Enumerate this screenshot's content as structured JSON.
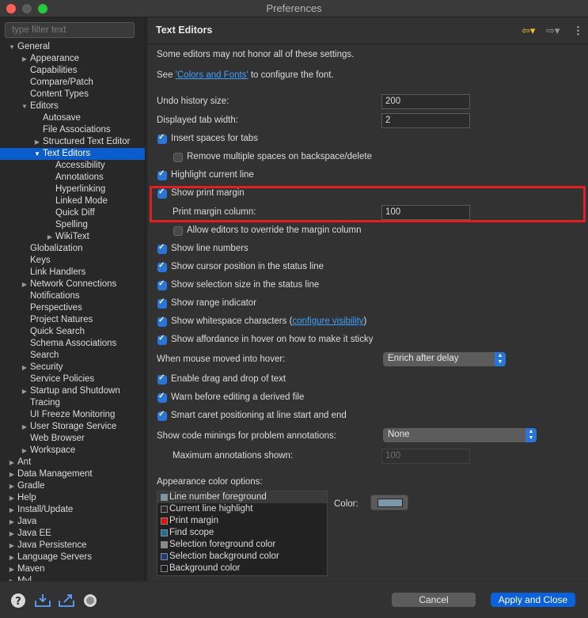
{
  "window": {
    "title": "Preferences"
  },
  "filter": {
    "placeholder": "type filter text"
  },
  "tree": [
    {
      "label": "General",
      "depth": 0,
      "twisty": "open"
    },
    {
      "label": "Appearance",
      "depth": 1,
      "twisty": "closed"
    },
    {
      "label": "Capabilities",
      "depth": 1,
      "twisty": ""
    },
    {
      "label": "Compare/Patch",
      "depth": 1,
      "twisty": ""
    },
    {
      "label": "Content Types",
      "depth": 1,
      "twisty": ""
    },
    {
      "label": "Editors",
      "depth": 1,
      "twisty": "open"
    },
    {
      "label": "Autosave",
      "depth": 2,
      "twisty": ""
    },
    {
      "label": "File Associations",
      "depth": 2,
      "twisty": ""
    },
    {
      "label": "Structured Text Editor",
      "depth": 2,
      "twisty": "closed"
    },
    {
      "label": "Text Editors",
      "depth": 2,
      "twisty": "open",
      "selected": true
    },
    {
      "label": "Accessibility",
      "depth": 3,
      "twisty": ""
    },
    {
      "label": "Annotations",
      "depth": 3,
      "twisty": ""
    },
    {
      "label": "Hyperlinking",
      "depth": 3,
      "twisty": ""
    },
    {
      "label": "Linked Mode",
      "depth": 3,
      "twisty": ""
    },
    {
      "label": "Quick Diff",
      "depth": 3,
      "twisty": ""
    },
    {
      "label": "Spelling",
      "depth": 3,
      "twisty": ""
    },
    {
      "label": "WikiText",
      "depth": 3,
      "twisty": "closed"
    },
    {
      "label": "Globalization",
      "depth": 1,
      "twisty": ""
    },
    {
      "label": "Keys",
      "depth": 1,
      "twisty": ""
    },
    {
      "label": "Link Handlers",
      "depth": 1,
      "twisty": ""
    },
    {
      "label": "Network Connections",
      "depth": 1,
      "twisty": "closed"
    },
    {
      "label": "Notifications",
      "depth": 1,
      "twisty": ""
    },
    {
      "label": "Perspectives",
      "depth": 1,
      "twisty": ""
    },
    {
      "label": "Project Natures",
      "depth": 1,
      "twisty": ""
    },
    {
      "label": "Quick Search",
      "depth": 1,
      "twisty": ""
    },
    {
      "label": "Schema Associations",
      "depth": 1,
      "twisty": ""
    },
    {
      "label": "Search",
      "depth": 1,
      "twisty": ""
    },
    {
      "label": "Security",
      "depth": 1,
      "twisty": "closed"
    },
    {
      "label": "Service Policies",
      "depth": 1,
      "twisty": ""
    },
    {
      "label": "Startup and Shutdown",
      "depth": 1,
      "twisty": "closed"
    },
    {
      "label": "Tracing",
      "depth": 1,
      "twisty": ""
    },
    {
      "label": "UI Freeze Monitoring",
      "depth": 1,
      "twisty": ""
    },
    {
      "label": "User Storage Service",
      "depth": 1,
      "twisty": "closed"
    },
    {
      "label": "Web Browser",
      "depth": 1,
      "twisty": ""
    },
    {
      "label": "Workspace",
      "depth": 1,
      "twisty": "closed"
    },
    {
      "label": "Ant",
      "depth": 0,
      "twisty": "closed"
    },
    {
      "label": "Data Management",
      "depth": 0,
      "twisty": "closed"
    },
    {
      "label": "Gradle",
      "depth": 0,
      "twisty": "closed"
    },
    {
      "label": "Help",
      "depth": 0,
      "twisty": "closed"
    },
    {
      "label": "Install/Update",
      "depth": 0,
      "twisty": "closed"
    },
    {
      "label": "Java",
      "depth": 0,
      "twisty": "closed"
    },
    {
      "label": "Java EE",
      "depth": 0,
      "twisty": "closed"
    },
    {
      "label": "Java Persistence",
      "depth": 0,
      "twisty": "closed"
    },
    {
      "label": "Language Servers",
      "depth": 0,
      "twisty": "closed"
    },
    {
      "label": "Maven",
      "depth": 0,
      "twisty": "closed"
    },
    {
      "label": "Myl",
      "depth": 0,
      "twisty": "closed"
    }
  ],
  "page": {
    "title": "Text Editors",
    "intro": "Some editors may not honor all of these settings.",
    "see_prefix": "See ",
    "see_link": "'Colors and Fonts'",
    "see_suffix": " to configure the font.",
    "undo_label": "Undo history size:",
    "undo_value": "200",
    "tab_width_label": "Displayed tab width:",
    "tab_width_value": "2",
    "insert_spaces": "Insert spaces for tabs",
    "remove_spaces": "Remove multiple spaces on backspace/delete",
    "highlight_line": "Highlight current line",
    "show_print_margin": "Show print margin",
    "print_margin_label": "Print margin column:",
    "print_margin_value": "100",
    "allow_override": "Allow editors to override the margin column",
    "show_line_numbers": "Show line numbers",
    "show_cursor_pos": "Show cursor position in the status line",
    "show_selection_size": "Show selection size in the status line",
    "show_range": "Show range indicator",
    "show_whitespace_prefix": "Show whitespace characters (",
    "show_whitespace_link": "configure visibility",
    "show_whitespace_suffix": ")",
    "show_affordance": "Show affordance in hover on how to make it sticky",
    "hover_label": "When mouse moved into hover:",
    "hover_value": "Enrich after delay",
    "drag_drop": "Enable drag and drop of text",
    "warn_derived": "Warn before editing a derived file",
    "smart_caret": "Smart caret positioning at line start and end",
    "minings_label": "Show code minings for problem annotations:",
    "minings_value": "None",
    "max_annotations_label": "Maximum annotations shown:",
    "max_annotations_value": "100",
    "appearance_label": "Appearance color options:",
    "color_label": "Color:",
    "color_value": "#7c98a8"
  },
  "color_options": [
    {
      "label": "Line number foreground",
      "swatch": "#7c98a8",
      "selected": true
    },
    {
      "label": "Current line highlight",
      "swatch": "#2a2a2a"
    },
    {
      "label": "Print margin",
      "swatch": "#e01010"
    },
    {
      "label": "Find scope",
      "swatch": "#1e6e9a"
    },
    {
      "label": "Selection foreground color",
      "swatch": "#8a8a8a"
    },
    {
      "label": "Selection background color",
      "swatch": "#1e3a78"
    },
    {
      "label": "Background color",
      "swatch": "#1e1e1e"
    }
  ],
  "footer": {
    "cancel": "Cancel",
    "apply_close": "Apply and Close",
    "icons": [
      "help-icon",
      "import-icon",
      "export-icon",
      "record-icon"
    ]
  }
}
